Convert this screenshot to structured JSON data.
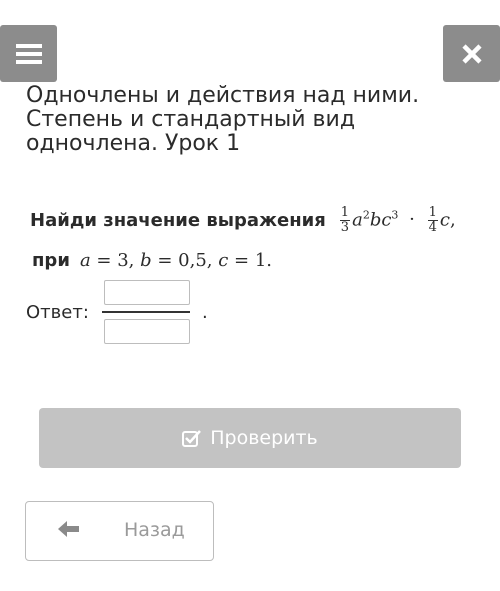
{
  "header": {
    "menu_icon": "hamburger-menu-icon",
    "close_icon": "close-x-icon",
    "title": "Одночлены и действия над ними. Степень и стандартный вид одночлена. Урок 1"
  },
  "task": {
    "prompt": "Найди значение выражения",
    "at_word": "при",
    "expression": "1/3 a²bc³ · 1/4 c,",
    "condition": "a = 3, b = 0,5, c = 1."
  },
  "answer": {
    "label": "Ответ:",
    "numerator_value": "",
    "denominator_value": "",
    "end_mark": "."
  },
  "buttons": {
    "check_label": "Проверить",
    "check_icon": "checkbox-check-icon",
    "back_label": "Назад",
    "back_icon": "arrow-left-icon"
  },
  "colors": {
    "icon_button_bg": "#8c8c8c",
    "check_button_bg": "#c3c3c3",
    "back_text": "#9a9a9a"
  }
}
